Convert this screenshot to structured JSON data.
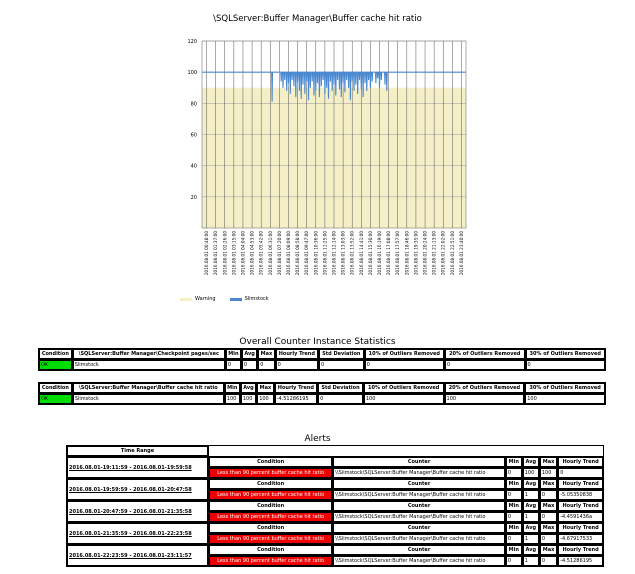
{
  "chart_data": {
    "type": "line",
    "title": "\\SQLServer:Buffer Manager\\Buffer cache hit ratio",
    "ylim": [
      0,
      120
    ],
    "yticks": [
      20,
      40,
      60,
      80,
      100,
      120
    ],
    "xlabels": [
      "2016.08.01 00:48:00",
      "2016.08.01 01:37:00",
      "2016.08.01 02:26:00",
      "2016.08.01 03:15:00",
      "2016.08.01 04:04:00",
      "2016.08.01 04:53:00",
      "2016.08.01 05:42:00",
      "2016.08.01 06:31:00",
      "2016.08.01 07:20:00",
      "2016.08.01 08:09:00",
      "2016.08.01 08:58:00",
      "2016.08.01 09:47:00",
      "2016.08.01 10:36:00",
      "2016.08.01 11:25:00",
      "2016.08.01 12:14:00",
      "2016.08.01 13:03:00",
      "2016.08.01 13:52:00",
      "2016.08.01 14:41:00",
      "2016.08.01 15:30:00",
      "2016.08.01 16:19:00",
      "2016.08.01 17:08:00",
      "2016.08.01 17:57:00",
      "2016.08.01 18:46:00",
      "2016.08.01 19:35:00",
      "2016.08.01 20:24:00",
      "2016.08.01 21:13:00",
      "2016.08.01 22:02:00",
      "2016.08.01 22:51:00",
      "2016.08.01 23:40:00"
    ],
    "warning_fill": "#f5efc8",
    "line_color": "#4a88d0",
    "series": [
      {
        "name": "Slimstock",
        "baseline": 100,
        "dips": [
          [
            7.7,
            81
          ],
          [
            8.7,
            94
          ],
          [
            8.9,
            90
          ],
          [
            9.1,
            95
          ],
          [
            9.3,
            88
          ],
          [
            9.5,
            93
          ],
          [
            9.7,
            86
          ],
          [
            9.9,
            95
          ],
          [
            10.1,
            91
          ],
          [
            10.3,
            84
          ],
          [
            10.5,
            94
          ],
          [
            10.7,
            88
          ],
          [
            10.9,
            83
          ],
          [
            11.1,
            92
          ],
          [
            11.3,
            86
          ],
          [
            11.5,
            94
          ],
          [
            11.7,
            82
          ],
          [
            11.9,
            90
          ],
          [
            12.1,
            94
          ],
          [
            12.3,
            85
          ],
          [
            12.5,
            88
          ],
          [
            12.7,
            93
          ],
          [
            12.9,
            84
          ],
          [
            13.1,
            91
          ],
          [
            13.3,
            95
          ],
          [
            13.5,
            86
          ],
          [
            13.7,
            90
          ],
          [
            13.9,
            83
          ],
          [
            14.1,
            94
          ],
          [
            14.3,
            88
          ],
          [
            14.5,
            92
          ],
          [
            14.7,
            85
          ],
          [
            14.9,
            95
          ],
          [
            15.1,
            89
          ],
          [
            15.3,
            84
          ],
          [
            15.5,
            93
          ],
          [
            15.7,
            87
          ],
          [
            15.9,
            95
          ],
          [
            16.1,
            90
          ],
          [
            16.3,
            82
          ],
          [
            16.5,
            94
          ],
          [
            16.7,
            88
          ],
          [
            16.9,
            92
          ],
          [
            17.1,
            86
          ],
          [
            17.3,
            95
          ],
          [
            17.5,
            89
          ],
          [
            17.7,
            84
          ],
          [
            17.9,
            93
          ],
          [
            18.1,
            88
          ],
          [
            18.3,
            95
          ],
          [
            18.5,
            90
          ],
          [
            18.7,
            94
          ],
          [
            19.1,
            93
          ],
          [
            19.3,
            96
          ],
          [
            19.5,
            90
          ],
          [
            19.7,
            95
          ],
          [
            20.1,
            92
          ],
          [
            20.3,
            88
          ]
        ]
      }
    ],
    "legend": [
      {
        "label": "Warning",
        "color": "#f5efc8"
      },
      {
        "label": "Slimstock",
        "color": "#4a88d0"
      }
    ]
  },
  "overall": {
    "title": "Overall Counter Instance Statistics",
    "tables": [
      {
        "headers": [
          "Condition",
          "\\SQLServer:Buffer Manager\\Checkpoint pages/sec",
          "Min",
          "Avg",
          "Max",
          "Hourly Trend",
          "Std Deviation",
          "10% of Outliers Removed",
          "20% of Outliers Removed",
          "30% of Outliers Removed"
        ],
        "row": [
          "OK",
          "Slimstock",
          "0",
          "0",
          "0",
          "0",
          "0",
          "0",
          "0",
          "0"
        ]
      },
      {
        "headers": [
          "Condition",
          "\\SQLServer:Buffer Manager\\Buffer cache hit ratio",
          "Min",
          "Avg",
          "Max",
          "Hourly Trend",
          "Std Deviation",
          "10% of Outliers Removed",
          "20% of Outliers Removed",
          "30% of Outliers Removed"
        ],
        "row": [
          "OK",
          "Slimstock",
          "100",
          "100",
          "100",
          "-4.51286195",
          "0",
          "100",
          "100",
          "100"
        ]
      }
    ]
  },
  "alerts": {
    "title": "Alerts",
    "time_range_header": "Time Range",
    "headers": [
      "Condition",
      "Counter",
      "Min",
      "Avg",
      "Max",
      "Hourly Trend"
    ],
    "groups": [
      {
        "range": "2016.08.01-19:11:59 - 2016.08.01-19:59:58",
        "condition": "Less than 90 percent buffer cache hit ratio",
        "counter": "\\\\Slimstock\\SQLServer:Buffer Manager\\Buffer cache hit ratio",
        "min": "0",
        "avg": "100",
        "max": "100",
        "trend": "0"
      },
      {
        "range": "2016.08.01-19:59:59 - 2016.08.01-20:47:58",
        "condition": "Less than 90 percent buffer cache hit ratio",
        "counter": "\\\\Slimstock\\SQLServer:Buffer Manager\\Buffer cache hit ratio",
        "min": "0",
        "avg": "1",
        "max": "0",
        "trend": "-5.05350838"
      },
      {
        "range": "2016.08.01-20:47:59 - 2016.08.01-21:35:58",
        "condition": "Less than 90 percent buffer cache hit ratio",
        "counter": "\\\\Slimstock\\SQLServer:Buffer Manager\\Buffer cache hit ratio",
        "min": "0",
        "avg": "1",
        "max": "0",
        "trend": "-4.4591436a"
      },
      {
        "range": "2016.08.01-21:35:59 - 2016.08.01-22:23:58",
        "condition": "Less than 90 percent buffer cache hit ratio",
        "counter": "\\\\Slimstock\\SQLServer:Buffer Manager\\Buffer cache hit ratio",
        "min": "0",
        "avg": "1",
        "max": "0",
        "trend": "-4.67917533"
      },
      {
        "range": "2016.08.01-22:23:59 - 2016.08.01-23:11:57",
        "condition": "Less than 90 percent buffer cache hit ratio",
        "counter": "\\\\Slimstock\\SQLServer:Buffer Manager\\Buffer cache hit ratio",
        "min": "0",
        "avg": "1",
        "max": "0",
        "trend": "-4.51286195"
      }
    ]
  }
}
